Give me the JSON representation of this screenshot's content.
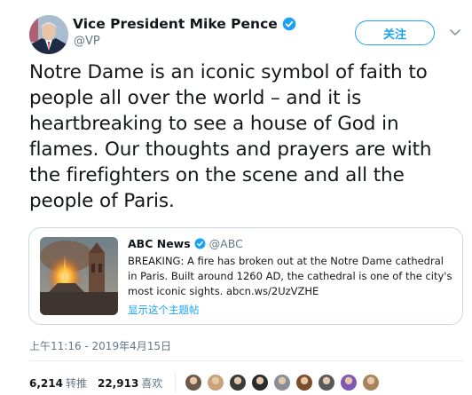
{
  "author": {
    "name": "Vice President Mike Pence",
    "handle": "@VP",
    "verified": true,
    "avatar_icon": "avatar-photo"
  },
  "follow_button": {
    "label": "关注"
  },
  "tweet": {
    "text": "Notre Dame is an iconic symbol of faith to people all over the world – and it is heartbreaking to see a house of God in flames. Our thoughts and prayers are with the firefighters on the scene and all the people of Paris."
  },
  "quoted_tweet": {
    "name": "ABC News",
    "handle": "@ABC",
    "verified": true,
    "text": "BREAKING: A fire has broken out at the Notre Dame cathedral in Paris. Built around 1260 AD, the cathedral is one of the city's most iconic sights. abcn.ws/2UzVZHE",
    "show_thread_label": "显示这个主题帖",
    "thumbnail_icon": "notre-dame-fire-photo"
  },
  "timestamp": "上午11:16 - 2019年4月15日",
  "stats": {
    "retweets_count": "6,214",
    "retweets_label": "转推",
    "likes_count": "22,913",
    "likes_label": "喜欢"
  },
  "likers": [
    {
      "color": "#6b5a4a"
    },
    {
      "color": "#c9a27a"
    },
    {
      "color": "#3a3a3a"
    },
    {
      "color": "#2b2b2b"
    },
    {
      "color": "#8a8f95"
    },
    {
      "color": "#7a4e2e"
    },
    {
      "color": "#5a5a5a"
    },
    {
      "color": "#7b59b5"
    },
    {
      "color": "#a7845c"
    }
  ],
  "colors": {
    "accent": "#1da1f2",
    "text_primary": "#14171a",
    "text_secondary": "#657786",
    "border": "#ccd6dd"
  }
}
